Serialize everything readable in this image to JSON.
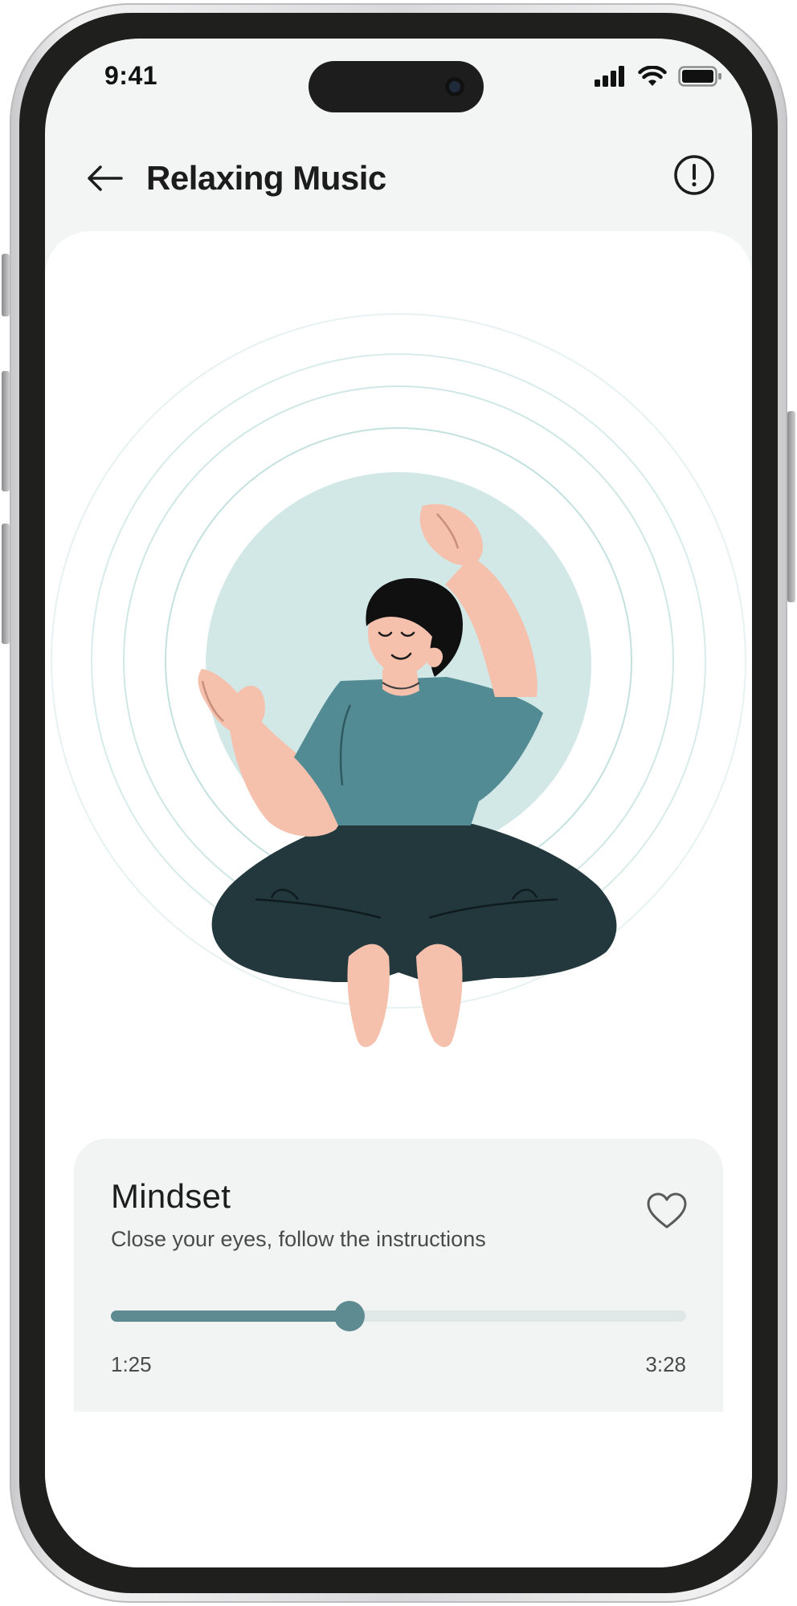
{
  "status_bar": {
    "time": "9:41",
    "icons": [
      "cellular-signal-icon",
      "wifi-icon",
      "battery-icon"
    ]
  },
  "header": {
    "title": "Relaxing Music",
    "back_icon": "arrow-left-icon",
    "info_icon": "info-circle-icon"
  },
  "illustration": {
    "subject": "meditating-person-illustration",
    "colors": {
      "halo": "#d2e8e7",
      "rings": "#bfe0de",
      "shirt": "#528b94",
      "pants": "#22383d",
      "skin": "#f5c1ad",
      "hair": "#101010"
    }
  },
  "player": {
    "track_title": "Mindset",
    "track_subtitle": "Close your eyes, follow the instructions",
    "favorite_icon": "heart-outline-icon",
    "progress_fraction": 0.415,
    "time_current": "1:25",
    "time_total": "3:28"
  },
  "colors": {
    "accent": "#5e8b91",
    "track_bg": "#dfe8e7",
    "screen_bg": "#f3f5f4",
    "card_bg": "#ffffff",
    "player_bg": "#f2f4f3"
  }
}
